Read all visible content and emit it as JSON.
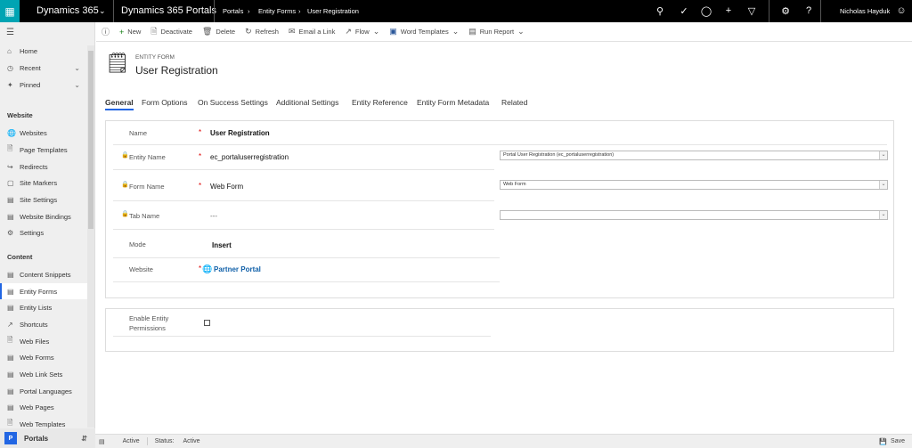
{
  "topbar": {
    "app": "Dynamics 365",
    "portal_app": "Dynamics 365 Portals",
    "breadcrumb": [
      "Portals",
      "Entity Forms",
      "User Registration"
    ],
    "user": "Nicholas Hayduk"
  },
  "commands": [
    "New",
    "Deactivate",
    "Delete",
    "Refresh",
    "Email a Link",
    "Flow",
    "Word Templates",
    "Run Report"
  ],
  "sidebar": {
    "top": [
      "Home",
      "Recent",
      "Pinned"
    ],
    "website_header": "Website",
    "website": [
      "Websites",
      "Page Templates",
      "Redirects",
      "Site Markers",
      "Site Settings",
      "Website Bindings",
      "Settings"
    ],
    "content_header": "Content",
    "content": [
      "Content Snippets",
      "Entity Forms",
      "Entity Lists",
      "Shortcuts",
      "Web Files",
      "Web Forms",
      "Web Link Sets",
      "Portal Languages",
      "Web Pages",
      "Web Templates"
    ],
    "area": "Portals",
    "area_badge": "P"
  },
  "header": {
    "entity": "ENTITY FORM",
    "title": "User Registration"
  },
  "tabs": [
    "General",
    "Form Options",
    "On Success Settings",
    "Additional Settings",
    "Entity Reference",
    "Entity Form Metadata",
    "Related"
  ],
  "form": {
    "name": {
      "label": "Name",
      "value": "User Registration"
    },
    "entity_name": {
      "label": "Entity Name",
      "value": "ec_portaluserregistration",
      "select": "Portal User Registration (ec_portaluserregistration)"
    },
    "form_name": {
      "label": "Form Name",
      "value": "Web Form",
      "select": "Web Form"
    },
    "tab_name": {
      "label": "Tab Name",
      "value": "---",
      "select": ""
    },
    "mode": {
      "label": "Mode",
      "value": "Insert"
    },
    "website": {
      "label": "Website",
      "value": "Partner Portal"
    },
    "permissions": {
      "label1": "Enable Entity",
      "label2": "Permissions",
      "checked": false
    }
  },
  "statusbar": {
    "state": "Active",
    "status_label": "Status:",
    "status": "Active",
    "save": "Save"
  },
  "colors": {
    "accent": "#2266e3",
    "waffle": "#00a4b3",
    "required": "#dd0000"
  }
}
